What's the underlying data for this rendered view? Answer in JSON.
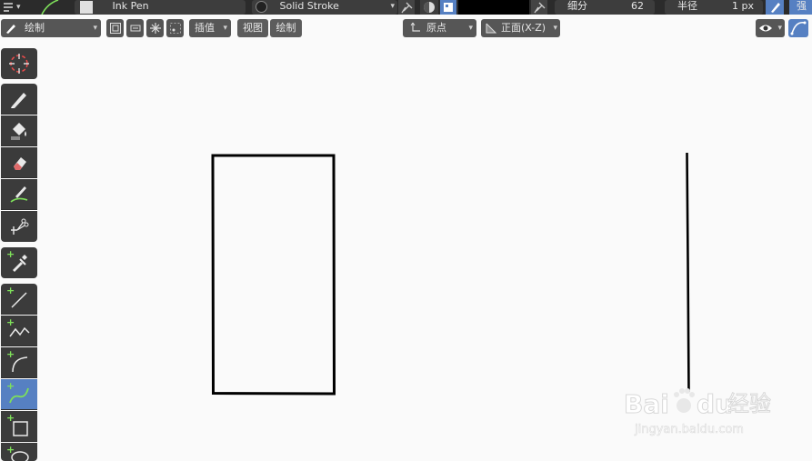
{
  "header": {
    "brush_name": "Ink Pen",
    "material_name": "Solid Stroke",
    "subdivision_label": "细分",
    "subdivision_value": "62",
    "radius_label": "半径",
    "radius_value": "1 px",
    "strength_label": "强"
  },
  "mode_bar": {
    "mode": "绘制",
    "interpolate": "插值",
    "view_menu": "视图",
    "draw_menu": "绘制",
    "origin": "原点",
    "orientation": "正面(X-Z)"
  },
  "tools": [
    {
      "name": "cursor-tool",
      "icon": "cursor-icon"
    },
    {
      "name": "draw-tool",
      "icon": "pencil-icon"
    },
    {
      "name": "fill-tool",
      "icon": "bucket-icon"
    },
    {
      "name": "erase-tool",
      "icon": "eraser-icon"
    },
    {
      "name": "tint-tool",
      "icon": "tint-brush-icon"
    },
    {
      "name": "cutter-tool",
      "icon": "scissors-icon"
    },
    {
      "name": "eyedropper-tool",
      "icon": "eyedropper-icon"
    },
    {
      "name": "line-tool",
      "icon": "line-icon"
    },
    {
      "name": "polyline-tool",
      "icon": "polyline-icon"
    },
    {
      "name": "arc-tool",
      "icon": "arc-icon"
    },
    {
      "name": "curve-tool",
      "icon": "curve-icon",
      "active": true
    },
    {
      "name": "box-tool",
      "icon": "box-icon"
    },
    {
      "name": "circle-tool",
      "icon": "circle-icon"
    }
  ],
  "watermark": {
    "brand": "Bai",
    "brand2": "du",
    "cn": "经验",
    "url": "jingyan.baidu.com"
  },
  "colors": {
    "active_tool": "#5680c2",
    "accent_green": "#7ee05a",
    "toolbar_bg": "#3b3b3b",
    "canvas_bg": "#fafafa"
  }
}
